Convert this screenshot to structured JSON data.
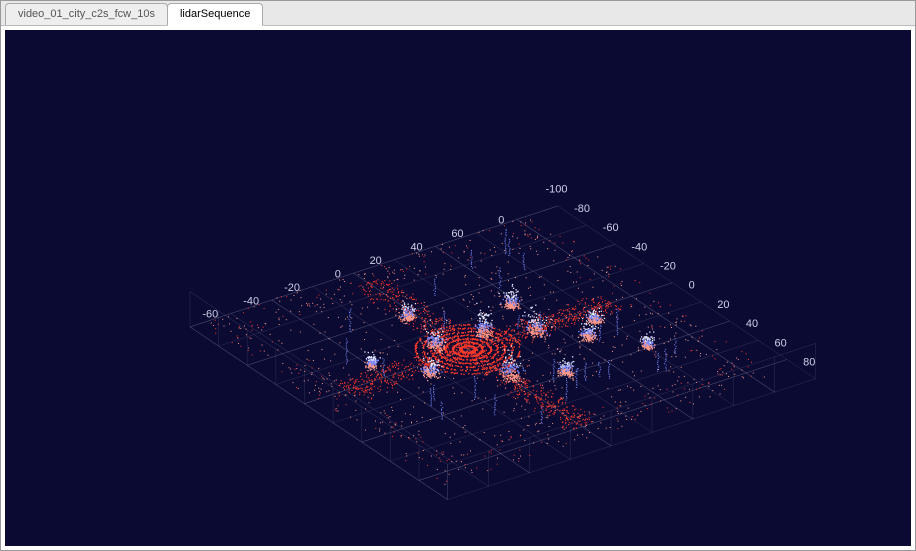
{
  "tabs": [
    {
      "label": "video_01_city_c2s_fcw_10s",
      "active": false
    },
    {
      "label": "lidarSequence",
      "active": true
    }
  ],
  "chart_data": {
    "type": "scatter",
    "title": "",
    "axes": {
      "x_ticks": [
        0,
        60,
        40,
        20,
        0,
        -20,
        -40,
        -60
      ],
      "y_ticks": [
        80,
        60,
        40,
        20,
        0,
        -20,
        -40,
        -60,
        -80,
        -100
      ],
      "x_range": [
        -80,
        80
      ],
      "y_range": [
        -100,
        100
      ],
      "z_range": [
        0,
        10
      ]
    },
    "colors": {
      "background": "#0a0a33",
      "grid": "#8888aa",
      "tick_text": "#cfcfe8",
      "point_low": "#ff3a2a",
      "point_mid": "#ff9a8a",
      "point_high": "#7a8aff",
      "point_top": "#e8e8ff"
    },
    "view": {
      "azimuth_deg": -35,
      "elevation_deg": 25
    },
    "points_note": "Dense LiDAR point cloud of an urban scene. Ground returns colored red (low z), vertical structures/objects colored blue-white (higher z). Concentric red ground rings visible near sensor origin. Clusters along two street corridors; scattered points out to ±80 on both ground axes."
  }
}
